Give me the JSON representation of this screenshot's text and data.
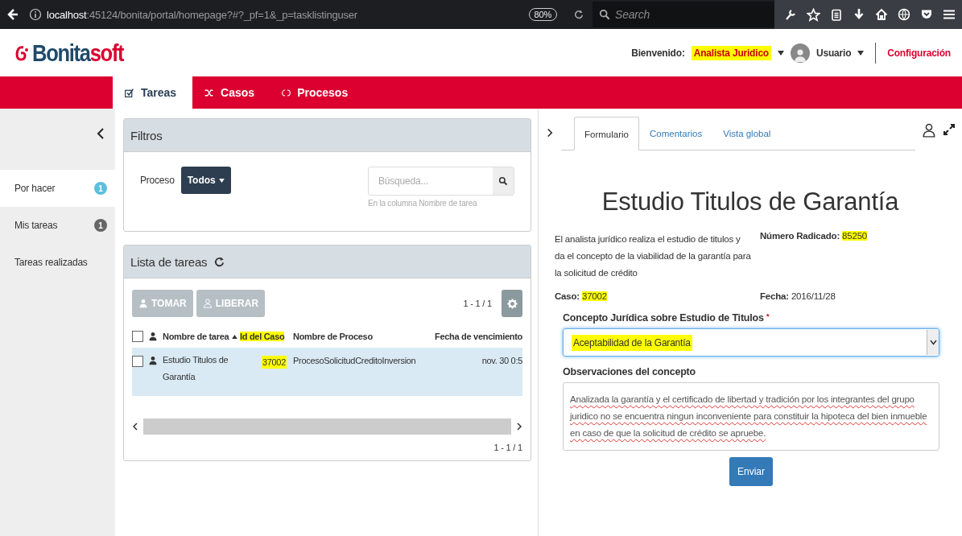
{
  "browser": {
    "url_host": "localhost",
    "url_rest": ":45124/bonita/portal/homepage?#?_pf=1&_p=tasklistinguser",
    "zoom": "80%",
    "search_placeholder": "Search"
  },
  "header": {
    "logo_part_1": "Bonita",
    "logo_part_2": "soft",
    "welcome_label": "Bienvenido:",
    "role": {
      "text": "Analista Juridico",
      "highlighted": true
    },
    "user": "Usuario",
    "settings": "Configuración"
  },
  "nav_tabs": [
    {
      "label": "Tareas",
      "selected": true
    },
    {
      "label": "Casos",
      "selected": false
    },
    {
      "label": "Procesos",
      "selected": false
    }
  ],
  "sidebar": {
    "items": [
      {
        "label": "Por hacer",
        "count": "1",
        "selected": true
      },
      {
        "label": "Mis tareas",
        "count": "1",
        "selected": false
      },
      {
        "label": "Tareas realizadas",
        "selected": false
      }
    ]
  },
  "filters": {
    "title": "Filtros",
    "process_label": "Proceso",
    "process_value": "Todos",
    "search_placeholder": "Búsqueda...",
    "search_hint": "En la columna Nombre de tarea"
  },
  "task_list": {
    "title": "Lista de tareas",
    "buttons": [
      {
        "label": "TOMAR",
        "disabled": true
      },
      {
        "label": "LIBERAR",
        "disabled": true
      }
    ],
    "pagination": "1 - 1 / 1",
    "select_all_checked": false,
    "columns": [
      {
        "label": "Nombre de tarea",
        "sorted": true,
        "highlighted": false
      },
      {
        "label": "Id del Caso",
        "sorted": false,
        "highlighted": true
      },
      {
        "label": "Nombre de Proceso",
        "sorted": false,
        "highlighted": false
      },
      {
        "label": "Fecha de vencimiento",
        "sorted": false,
        "highlighted": false
      }
    ],
    "rows": [
      {
        "selected": true,
        "checked": false,
        "task": "Estudio Titulos de Garantía",
        "case_id": {
          "text": "37002",
          "highlighted": true
        },
        "process": "ProcesoSolicitudCreditoInversion",
        "due": "nov. 30 0:5"
      }
    ],
    "footer_pagination": "1 - 1 / 1"
  },
  "detail": {
    "tabs": [
      {
        "label": "Formulario",
        "selected": true
      },
      {
        "label": "Comentarios",
        "selected": false
      },
      {
        "label": "Vista global",
        "selected": false
      }
    ],
    "form": {
      "title": "Estudio Titulos de Garantía",
      "description": "El analista jurídico realiza el estudio de titulos y da el concepto de la viabilidad de la garantía para la solicitud de crédito",
      "fields": [
        {
          "label": "Número Radicado:",
          "value": "85250",
          "highlighted": true
        },
        {
          "label": "Caso:",
          "value": "37002",
          "highlighted": true
        },
        {
          "label": "Fecha:",
          "value": "2016/11/28",
          "highlighted": false
        }
      ],
      "concept_label": "Concepto Jurídica sobre Estudio de Titulos",
      "required_mark": "*",
      "concept_value": {
        "text": "Aceptabilidad de la Garantía",
        "highlighted": true
      },
      "observations_label": "Observaciones del concepto",
      "observations_value": "Analizada la garantía y el certificado de libertad y tradición por los integrantes del grupo juridico no se encuentra ningun inconveniente para constituir la hipoteca del bien inmueble en caso de que la solicitud de crédito se apruebe.",
      "submit": "Enviar"
    }
  }
}
